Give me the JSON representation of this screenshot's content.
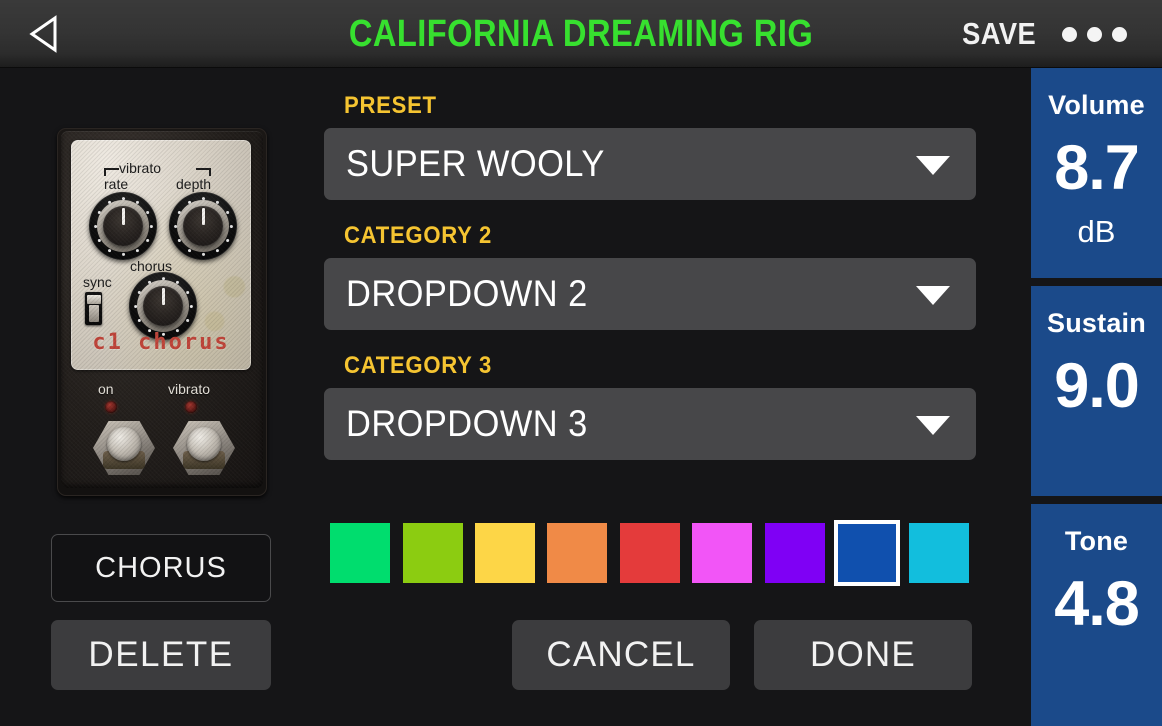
{
  "topbar": {
    "back_icon": "back-triangle-icon",
    "title": "CALIFORNIA DREAMING RIG",
    "save_label": "SAVE",
    "menu_icon": "overflow-dots-icon",
    "title_color": "#37e02f"
  },
  "pedal": {
    "name": "C1 CHORUS",
    "brand_text": "c1 chorus",
    "labels": {
      "vibrato_bracket": "vibrato",
      "rate": "rate",
      "depth": "depth",
      "chorus": "chorus",
      "sync": "sync",
      "footswitch_on": "on",
      "footswitch_vibrato": "vibrato"
    }
  },
  "left_buttons": {
    "chorus_label": "CHORUS",
    "delete_label": "DELETE"
  },
  "form": {
    "fields": [
      {
        "label": "PRESET",
        "value": "SUPER WOOLY",
        "caret_icon": "chevron-down-icon"
      },
      {
        "label": "CATEGORY 2",
        "value": "DROPDOWN 2",
        "caret_icon": "chevron-down-icon"
      },
      {
        "label": "CATEGORY 3",
        "value": "DROPDOWN 3",
        "caret_icon": "chevron-down-icon"
      }
    ],
    "label_color": "#f5c431",
    "field_bg": "#474749"
  },
  "swatches": {
    "selected_index": 7,
    "colors": [
      {
        "name": "spring-green",
        "hex": "#00dd6e"
      },
      {
        "name": "yellow-green",
        "hex": "#8ccc11"
      },
      {
        "name": "yellow",
        "hex": "#fdd647"
      },
      {
        "name": "orange",
        "hex": "#f08a47"
      },
      {
        "name": "red",
        "hex": "#e43b3b"
      },
      {
        "name": "magenta",
        "hex": "#f255f7"
      },
      {
        "name": "purple",
        "hex": "#7f00f5"
      },
      {
        "name": "blue",
        "hex": "#1050ae"
      },
      {
        "name": "cyan",
        "hex": "#12bedd"
      }
    ]
  },
  "bottom_buttons": {
    "cancel_label": "CANCEL",
    "done_label": "DONE"
  },
  "sidebar": {
    "panel_color": "#1b4a8a",
    "panels": [
      {
        "name": "Volume",
        "value": "8.7",
        "unit": "dB"
      },
      {
        "name": "Sustain",
        "value": "9.0",
        "unit": ""
      },
      {
        "name": "Tone",
        "value": "4.8",
        "unit": ""
      }
    ]
  }
}
